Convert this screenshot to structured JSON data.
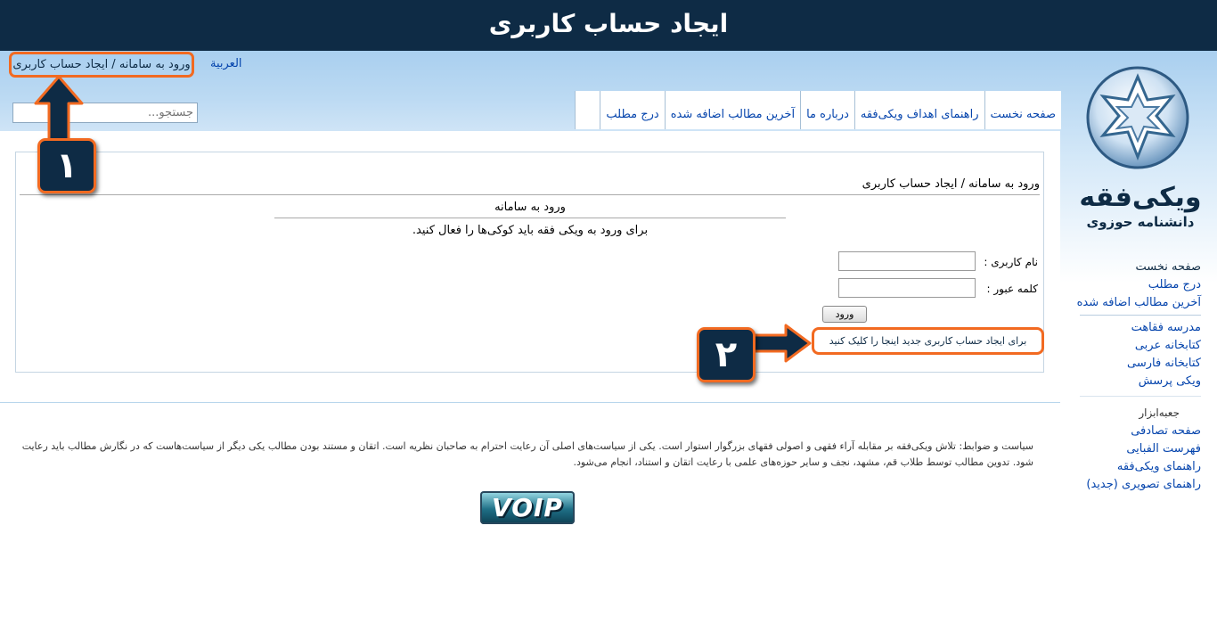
{
  "banner": {
    "title": "ایجاد حساب کاربری"
  },
  "logo": {
    "main": "ویکی‌فقه",
    "sub": "دانشنامه حوزوی"
  },
  "language_link": "العربية",
  "breadcrumb_top": "ورود به سامانه / ایجاد حساب کاربری",
  "search": {
    "placeholder": "جستجو..."
  },
  "tabs": [
    {
      "label": "صفحه نخست"
    },
    {
      "label": "راهنمای اهداف ویکی‌فقه"
    },
    {
      "label": "درباره ما"
    },
    {
      "label": "آخرین مطالب اضافه شده"
    },
    {
      "label": "درج مطلب"
    }
  ],
  "sidebar": {
    "nav": [
      {
        "label": "صفحه نخست"
      },
      {
        "label": "درج مطلب"
      },
      {
        "label": "آخرین مطالب اضافه شده"
      }
    ],
    "libraries": [
      {
        "label": "مدرسه فقاهت"
      },
      {
        "label": "کتابخانه عربی"
      },
      {
        "label": "کتابخانه فارسی"
      },
      {
        "label": "ویکی پرسش"
      }
    ],
    "toolbox_heading": "جعبه‌ابزار",
    "toolbox": [
      {
        "label": "صفحه تصادفی"
      },
      {
        "label": "فهرست الفبایی"
      },
      {
        "label": "راهنمای ویکی‌فقه"
      },
      {
        "label": "راهنمای تصویری (جدید)"
      }
    ]
  },
  "content": {
    "page_heading": "ورود به سامانه / ایجاد حساب کاربری",
    "login_heading": "ورود به سامانه",
    "cookie_message": "برای ورود به ویکی فقه باید کوکی‌ها را فعال کنید.",
    "username_label": "نام کاربری :",
    "password_label": "کلمه عبور :",
    "login_button": "ورود",
    "create_account_link": "برای ایجاد حساب کاربری جدید اینجا را کلیک کنید"
  },
  "footer": {
    "policy_text": "سیاست و ضوابط: تلاش ویکی‌فقه بر مقابله آراء فقهی و اصولی فقهای بزرگوار استوار است. یکی از سیاست‌های اصلی آن رعایت احترام به صاحبان نظریه است. اتقان و مستند بودن مطالب یکی دیگر از سیاست‌هاست که در نگارش مطالب باید رعایت شود. تدوین مطالب توسط طلاب قم، مشهد، نجف و سایر حوزه‌های علمی با رعایت اتقان و استناد، انجام می‌شود.",
    "badge_text": "VOIP"
  },
  "callouts": {
    "first": "۱",
    "second": "۲"
  },
  "colors": {
    "banner": "#0e2b45",
    "highlight": "#f26a21",
    "link": "#0645ad"
  }
}
